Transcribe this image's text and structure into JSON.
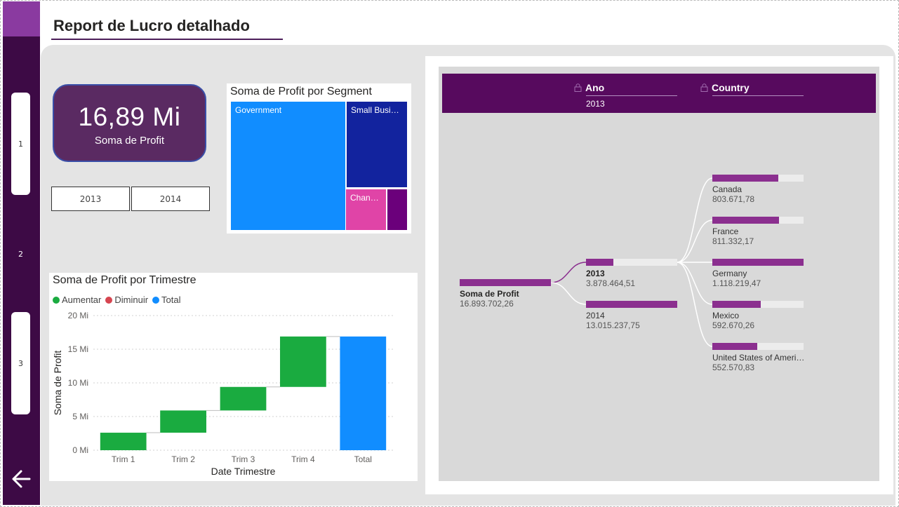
{
  "report": {
    "title": "Report de Lucro detalhado"
  },
  "nav": {
    "pages": [
      "1",
      "2",
      "3"
    ],
    "back_icon": "arrow-left-icon"
  },
  "kpi": {
    "value": "16,89 Mi",
    "label": "Soma de Profit"
  },
  "year_slicer": {
    "options": [
      "2013",
      "2014"
    ]
  },
  "treemap": {
    "title": "Soma de Profit por Segment",
    "tiles": [
      {
        "label": "Government",
        "color": "#118dff"
      },
      {
        "label": "Small Business",
        "color": "#12239e"
      },
      {
        "label": "Channel Partners",
        "color": "#e044a7"
      },
      {
        "label": "",
        "color": "#6b007b"
      }
    ]
  },
  "waterfall": {
    "title": "Soma de Profit por Trimestre",
    "legend": [
      {
        "label": "Aumentar",
        "color": "#1aab40"
      },
      {
        "label": "Diminuir",
        "color": "#d64550"
      },
      {
        "label": "Total",
        "color": "#118dff"
      }
    ]
  },
  "chart_data": {
    "type": "bar",
    "subtype": "waterfall",
    "title": "Soma de Profit por Trimestre",
    "xlabel": "Date Trimestre",
    "ylabel": "Soma de Profit",
    "categories": [
      "Trim 1",
      "Trim 2",
      "Trim 3",
      "Trim 4",
      "Total"
    ],
    "steps": [
      {
        "category": "Trim 1",
        "start": 0,
        "end": 2.6,
        "kind": "Aumentar"
      },
      {
        "category": "Trim 2",
        "start": 2.6,
        "end": 5.9,
        "kind": "Aumentar"
      },
      {
        "category": "Trim 3",
        "start": 5.9,
        "end": 9.4,
        "kind": "Aumentar"
      },
      {
        "category": "Trim 4",
        "start": 9.4,
        "end": 16.89,
        "kind": "Aumentar"
      },
      {
        "category": "Total",
        "start": 0,
        "end": 16.89,
        "kind": "Total"
      }
    ],
    "yticks": [
      "0 Mi",
      "5 Mi",
      "10 Mi",
      "15 Mi",
      "20 Mi"
    ],
    "ylim": [
      0,
      20
    ],
    "grid": true,
    "legend_position": "top-left"
  },
  "decomposition": {
    "levels": [
      {
        "name": "Ano",
        "selected": "2013"
      },
      {
        "name": "Country",
        "selected": ""
      }
    ],
    "root": {
      "label": "Soma de Profit",
      "value": "16.893.702,26"
    },
    "years": [
      {
        "label": "2013",
        "value": "3.878.464,51",
        "fraction": 0.3,
        "selected": true
      },
      {
        "label": "2014",
        "value": "13.015.237,75",
        "fraction": 1.0,
        "selected": false
      }
    ],
    "countries": [
      {
        "label": "Canada",
        "value": "803.671,78",
        "fraction": 0.72
      },
      {
        "label": "France",
        "value": "811.332,17",
        "fraction": 0.73
      },
      {
        "label": "Germany",
        "value": "1.118.219,47",
        "fraction": 1.0
      },
      {
        "label": "Mexico",
        "value": "592.670,26",
        "fraction": 0.53
      },
      {
        "label": "United States of America",
        "value": "552.570,83",
        "fraction": 0.49
      }
    ]
  },
  "colors": {
    "accent": "#570a5e",
    "bar": "#8b2f8f",
    "rail": "#3d0a45"
  }
}
